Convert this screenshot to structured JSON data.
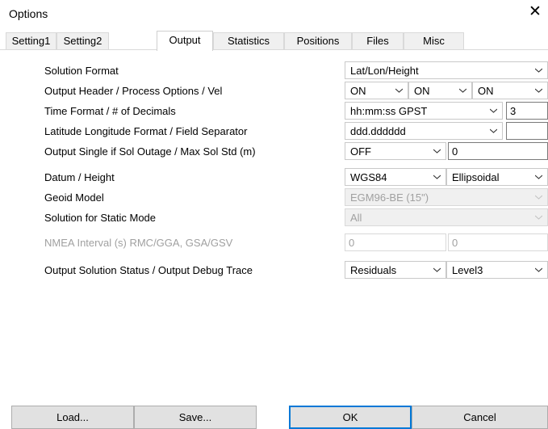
{
  "window": {
    "title": "Options",
    "close_glyph": "✕"
  },
  "tabs": [
    {
      "label": "Setting1"
    },
    {
      "label": "Setting2"
    },
    {
      "label": "Output",
      "active": true
    },
    {
      "label": "Statistics"
    },
    {
      "label": "Positions"
    },
    {
      "label": "Files"
    },
    {
      "label": "Misc"
    }
  ],
  "rows": {
    "solution_format": {
      "label": "Solution Format",
      "value": "Lat/Lon/Height"
    },
    "output_header": {
      "label": "Output Header / Process Options / Vel",
      "header": "ON",
      "process_options": "ON",
      "vel": "ON"
    },
    "time_format": {
      "label": "Time Format / # of Decimals",
      "value": "hh:mm:ss GPST",
      "decimals": "3"
    },
    "latlon_format": {
      "label": "Latitude Longitude Format / Field Separator",
      "value": "ddd.dddddd",
      "separator": ""
    },
    "sol_outage": {
      "label": "Output Single if Sol Outage / Max Sol Std (m)",
      "value": "OFF",
      "max_std": "0"
    },
    "datum": {
      "label": "Datum / Height",
      "datum": "WGS84",
      "height": "Ellipsoidal"
    },
    "geoid": {
      "label": "Geoid Model",
      "value": "EGM96-BE (15\")",
      "disabled": true
    },
    "static_mode": {
      "label": "Solution for Static Mode",
      "value": "All",
      "disabled": true
    },
    "nmea": {
      "label": "NMEA Interval (s) RMC/GGA, GSA/GSV",
      "rmc_gga": "0",
      "gsa_gsv": "0",
      "disabled": true
    },
    "solution_status": {
      "label": "Output Solution Status / Output Debug Trace",
      "status": "Residuals",
      "trace": "Level3"
    }
  },
  "buttons": {
    "load": "Load...",
    "save": "Save...",
    "ok": "OK",
    "cancel": "Cancel"
  },
  "colors": {
    "accent": "#0078d7",
    "disabled_text": "#a0a0a0",
    "button_bg": "#e1e1e1"
  },
  "icons": {
    "dropdown": "chevron-down-icon",
    "close": "close-icon"
  }
}
